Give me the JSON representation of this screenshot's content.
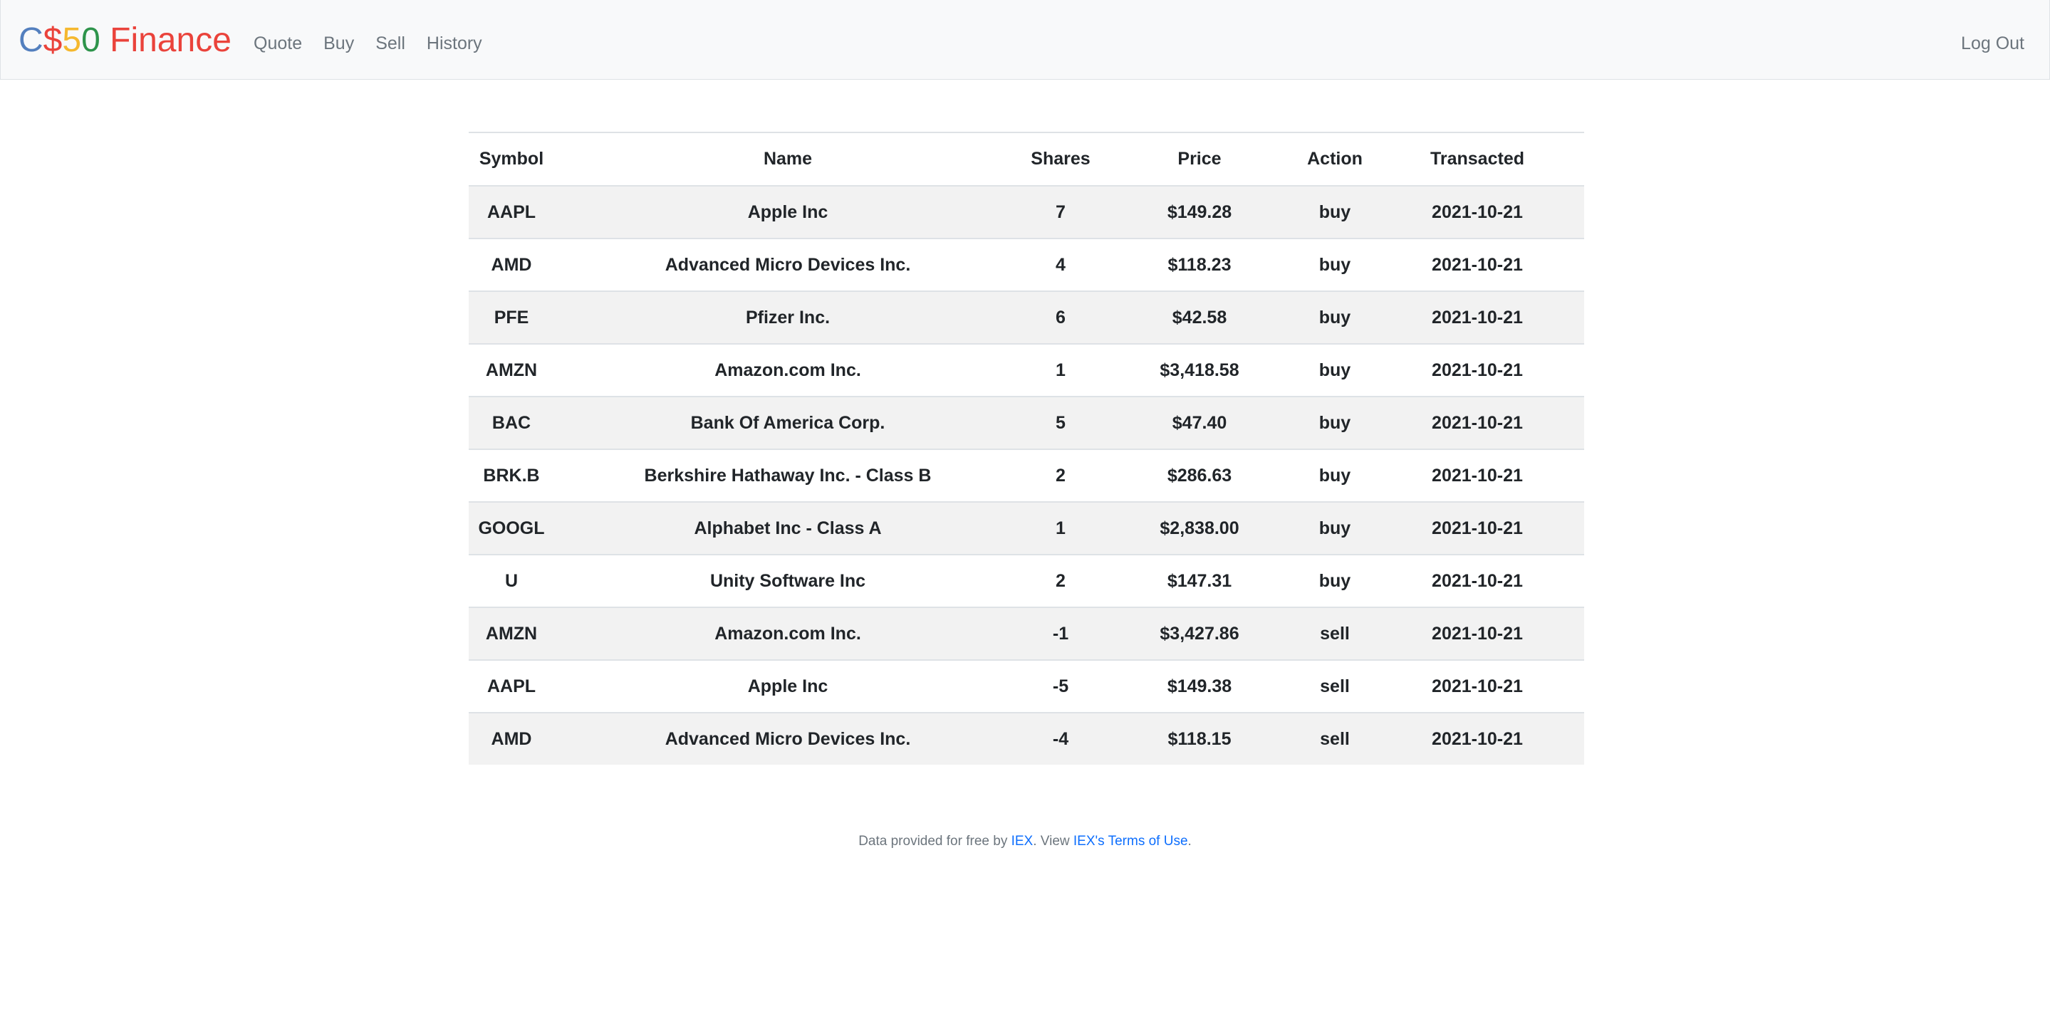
{
  "brand": {
    "parts": [
      {
        "text": "C",
        "color": "#537fbe"
      },
      {
        "text": "$",
        "color": "#ea433b"
      },
      {
        "text": "5",
        "color": "#f5b82e"
      },
      {
        "text": "0",
        "color": "#2e944b"
      },
      {
        "text": " Finance",
        "color": "#ea433b"
      }
    ]
  },
  "nav": {
    "items": [
      "Quote",
      "Buy",
      "Sell",
      "History"
    ],
    "logout": "Log Out"
  },
  "table": {
    "headers": [
      "Symbol",
      "Name",
      "Shares",
      "Price",
      "Action",
      "Transacted"
    ],
    "rows": [
      [
        "AAPL",
        "Apple Inc",
        "7",
        "$149.28",
        "buy",
        "2021-10-21"
      ],
      [
        "AMD",
        "Advanced Micro Devices Inc.",
        "4",
        "$118.23",
        "buy",
        "2021-10-21"
      ],
      [
        "PFE",
        "Pfizer Inc.",
        "6",
        "$42.58",
        "buy",
        "2021-10-21"
      ],
      [
        "AMZN",
        "Amazon.com Inc.",
        "1",
        "$3,418.58",
        "buy",
        "2021-10-21"
      ],
      [
        "BAC",
        "Bank Of America Corp.",
        "5",
        "$47.40",
        "buy",
        "2021-10-21"
      ],
      [
        "BRK.B",
        "Berkshire Hathaway Inc. - Class B",
        "2",
        "$286.63",
        "buy",
        "2021-10-21"
      ],
      [
        "GOOGL",
        "Alphabet Inc - Class A",
        "1",
        "$2,838.00",
        "buy",
        "2021-10-21"
      ],
      [
        "U",
        "Unity Software Inc",
        "2",
        "$147.31",
        "buy",
        "2021-10-21"
      ],
      [
        "AMZN",
        "Amazon.com Inc.",
        "-1",
        "$3,427.86",
        "sell",
        "2021-10-21"
      ],
      [
        "AAPL",
        "Apple Inc",
        "-5",
        "$149.38",
        "sell",
        "2021-10-21"
      ],
      [
        "AMD",
        "Advanced Micro Devices Inc.",
        "-4",
        "$118.15",
        "sell",
        "2021-10-21"
      ]
    ]
  },
  "footer": {
    "prefix": "Data provided for free by ",
    "iex_link": "IEX",
    "middle": ". View ",
    "terms_link": "IEX's Terms of Use",
    "suffix": "."
  }
}
